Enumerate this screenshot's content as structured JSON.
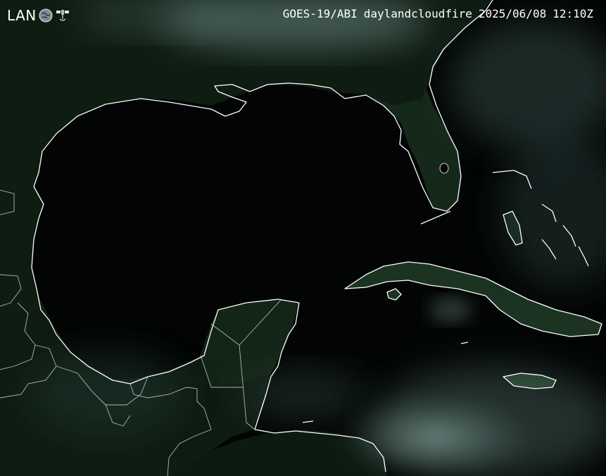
{
  "logo": {
    "text": "LAN"
  },
  "caption": {
    "instrument": "GOES-19/ABI",
    "product": "daylandcloudfire",
    "date": "2025/06/08",
    "time": "12:10Z"
  },
  "colors": {
    "ocean": "#020504",
    "land": "#0f1f14",
    "land_lit": "#26402a",
    "cloud": "#6f8d87",
    "coastline": "#ffffff",
    "border": "#cfcfcf",
    "text": "#ffffff"
  },
  "icons": [
    "globe-icon",
    "satellite-icon"
  ]
}
